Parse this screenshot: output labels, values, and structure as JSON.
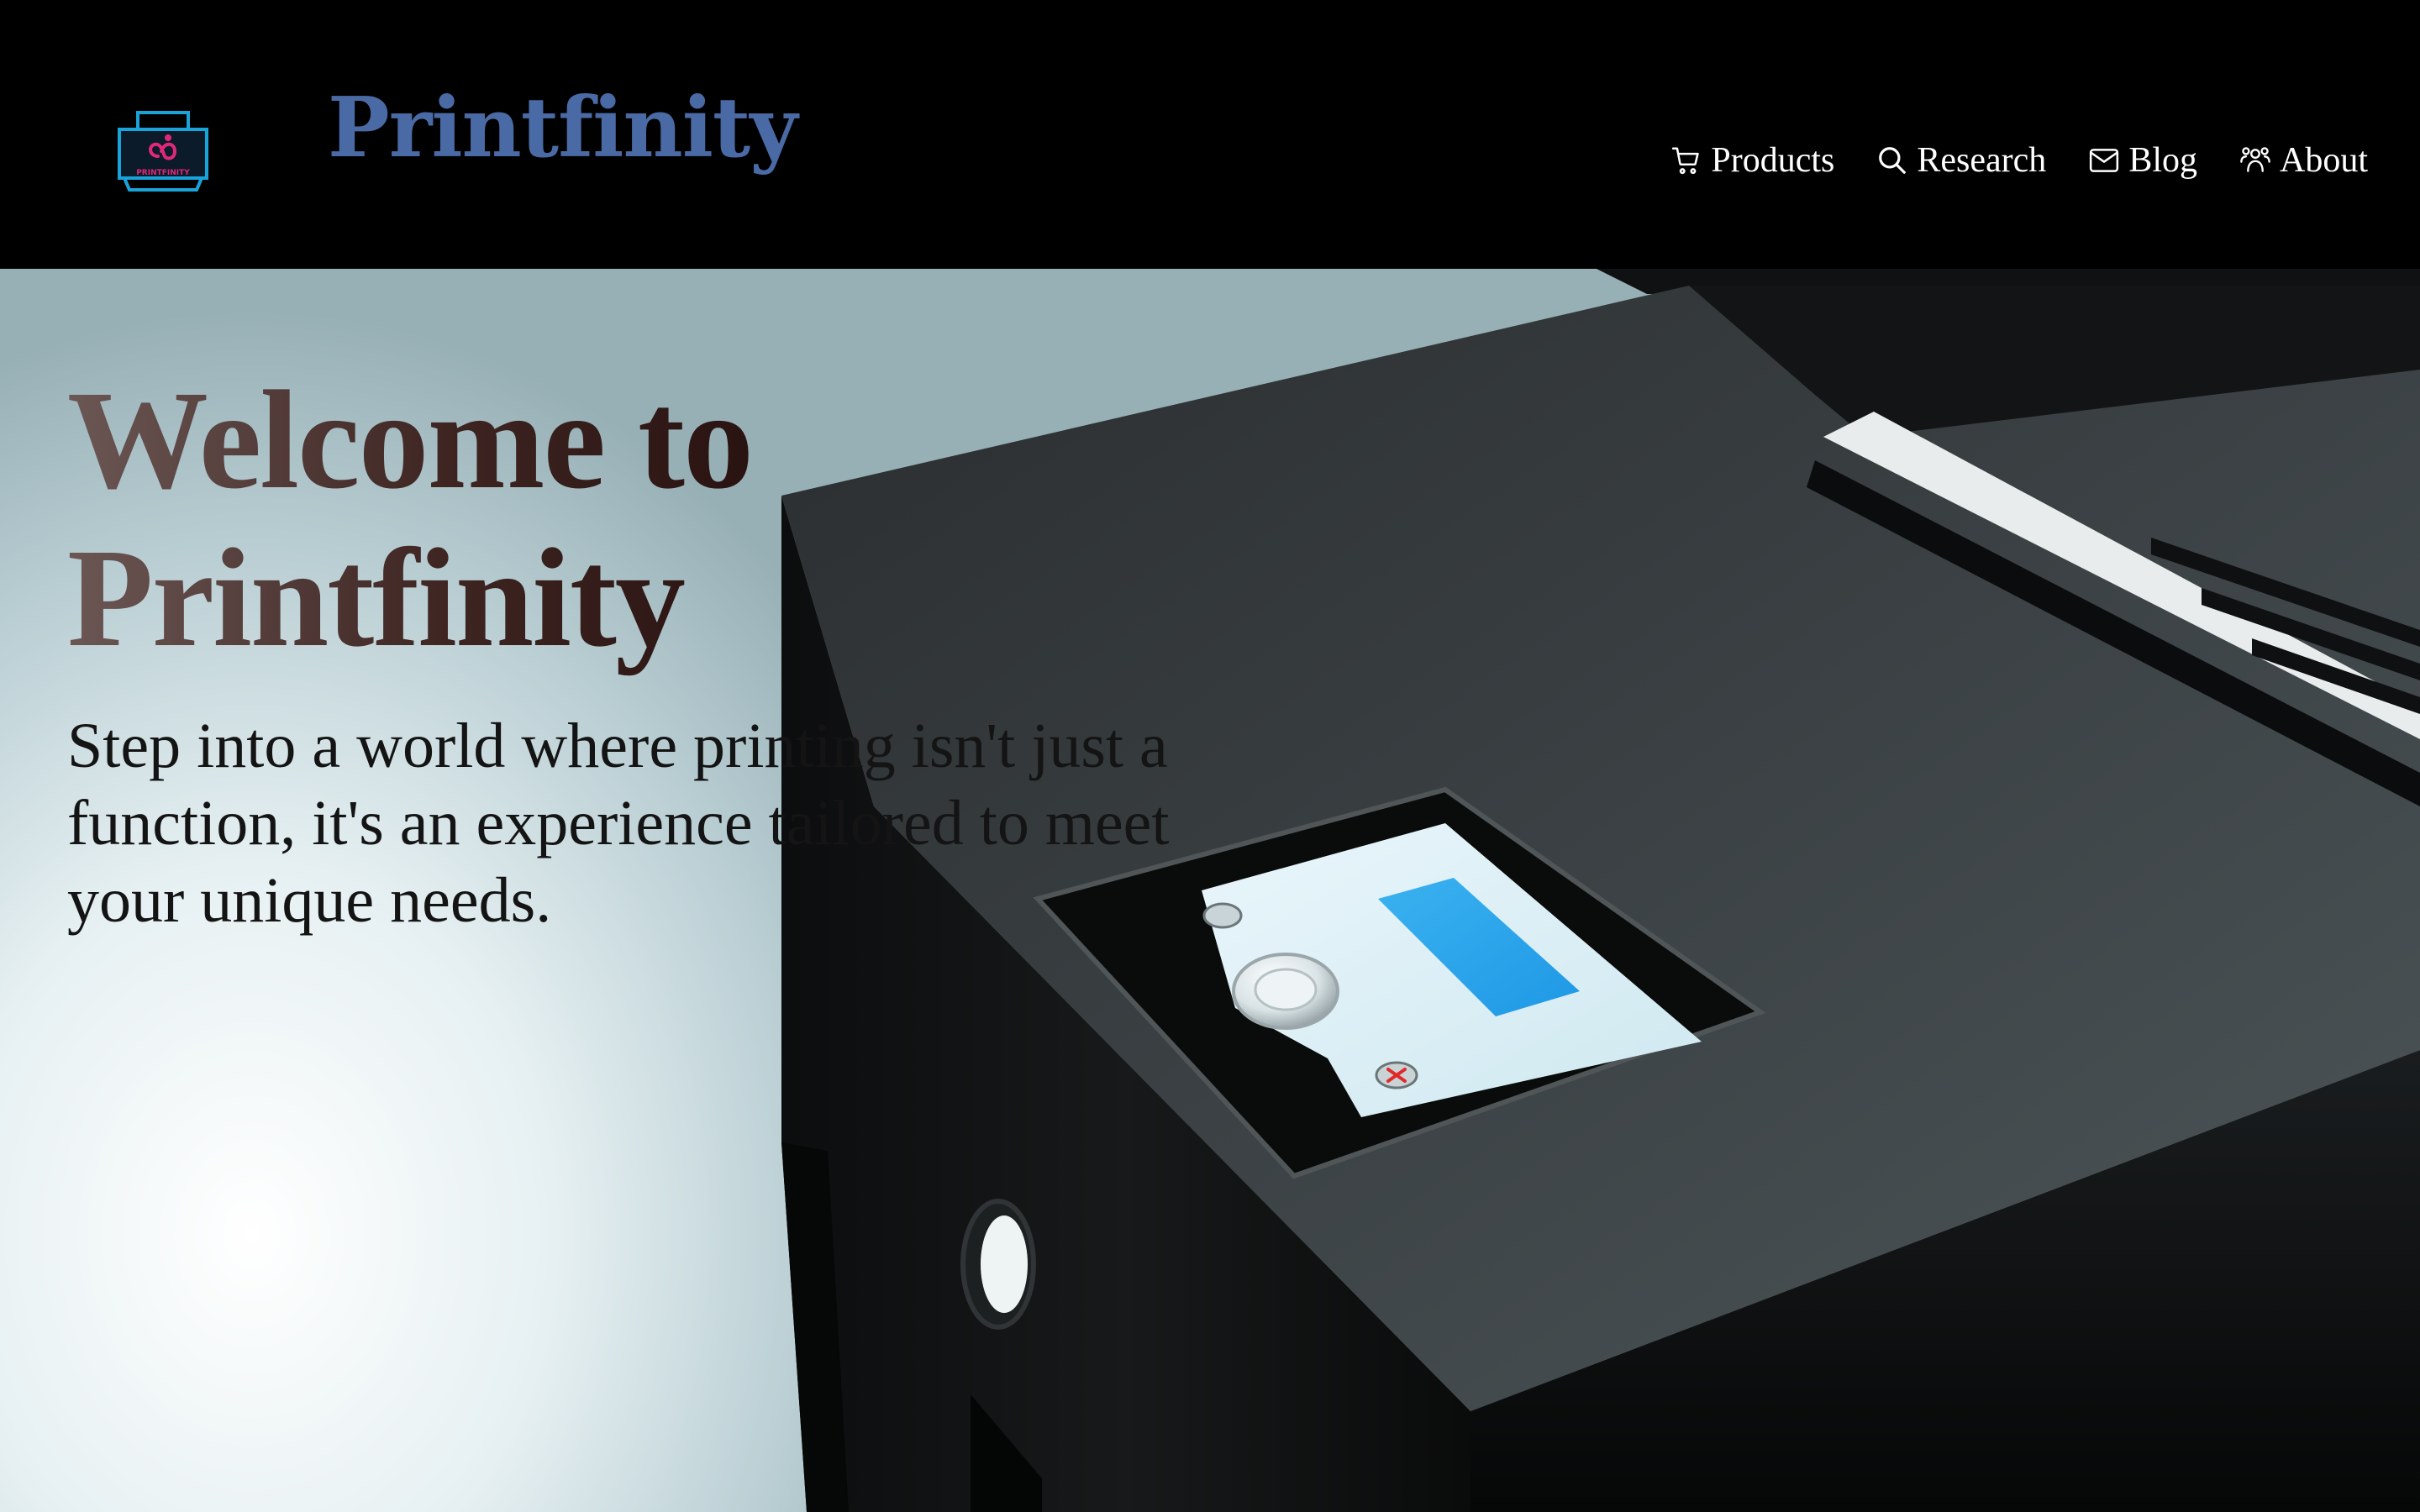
{
  "brand": {
    "name": "Printfinity",
    "logo_icon": "printer-logo-icon",
    "logo_text": "PRINTFINITY",
    "colors": {
      "brand_text": "#4a6aa5",
      "logo_cyan": "#1aa3d9",
      "logo_pink": "#e0287a"
    }
  },
  "nav": {
    "items": [
      {
        "label": "Products",
        "icon": "cart-icon"
      },
      {
        "label": "Research",
        "icon": "search-icon"
      },
      {
        "label": "Blog",
        "icon": "envelope-icon"
      },
      {
        "label": "About",
        "icon": "people-icon"
      }
    ]
  },
  "hero": {
    "title_line1": "Welcome to",
    "title_line2": "Printfinity",
    "subtitle": "Step into a world where printing isn't just a function, it's an experience tailored to meet your unique needs.",
    "background_image": "printer-closeup-image"
  }
}
